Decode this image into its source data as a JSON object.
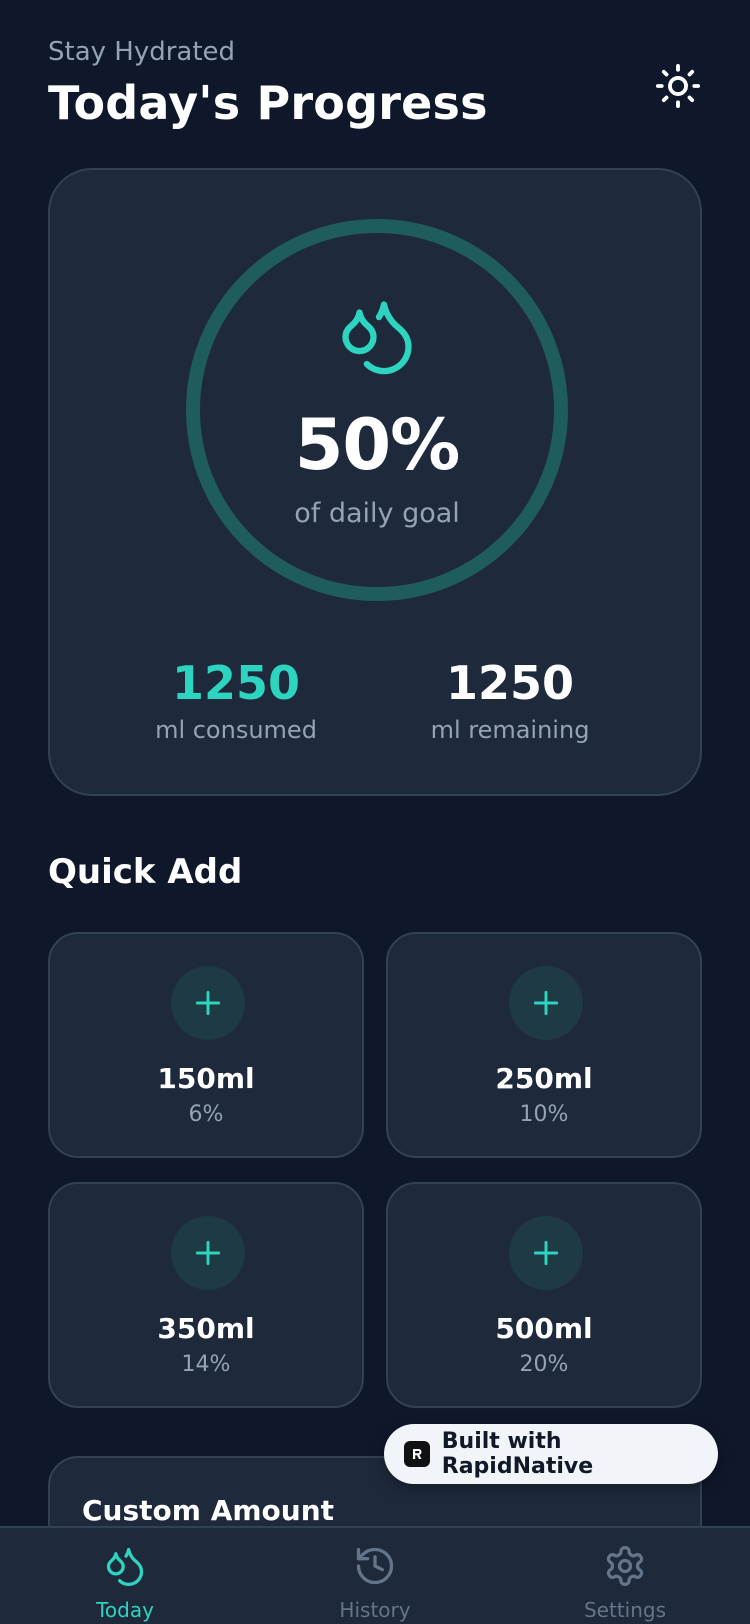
{
  "header": {
    "subtitle": "Stay Hydrated",
    "title": "Today's Progress",
    "theme_icon": "sun-icon"
  },
  "progress": {
    "percent_label": "50%",
    "percent_value": 0.5,
    "caption": "of daily goal",
    "icon": "water-drops-icon",
    "consumed": {
      "value": "1250",
      "label": "ml consumed"
    },
    "remaining": {
      "value": "1250",
      "label": "ml remaining"
    }
  },
  "quick_add": {
    "title": "Quick Add",
    "items": [
      {
        "amount": "150ml",
        "share": "6%"
      },
      {
        "amount": "250ml",
        "share": "10%"
      },
      {
        "amount": "350ml",
        "share": "14%"
      },
      {
        "amount": "500ml",
        "share": "20%"
      }
    ]
  },
  "custom": {
    "title": "Custom Amount"
  },
  "badge": {
    "text": "Built with RapidNative"
  },
  "tabs": [
    {
      "label": "Today",
      "icon": "water-drops-icon",
      "active": true
    },
    {
      "label": "History",
      "icon": "history-icon",
      "active": false
    },
    {
      "label": "Settings",
      "icon": "gear-icon",
      "active": false
    }
  ],
  "colors": {
    "background": "#0f172a",
    "card": "#1e293b",
    "accent": "#2dd4bf",
    "ring_track": "#1f5c5c",
    "muted": "#94a3b8"
  }
}
